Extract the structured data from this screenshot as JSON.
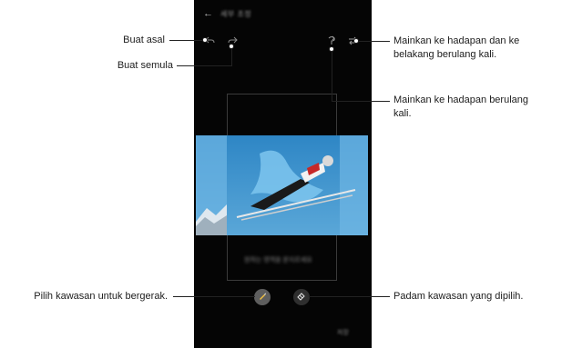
{
  "screen": {
    "title_blurred": "세부 조정",
    "caption_blurred": "원하는 영역을 문지르세요",
    "bottom_blurred": "저장"
  },
  "callouts": {
    "undo": "Buat asal",
    "redo": "Buat semula",
    "loop_forward_backward": [
      "Mainkan ke hadapan dan ke",
      "belakang berulang kali."
    ],
    "loop_forward": [
      "Mainkan ke hadapan berulang",
      "kali."
    ],
    "brush": "Pilih kawasan untuk bergerak.",
    "eraser": "Padam kawasan yang dipilih."
  },
  "icons": [
    "back-arrow-icon",
    "undo-icon",
    "redo-icon",
    "loop-forward-icon",
    "loop-forward-backward-icon",
    "brush-icon",
    "eraser-icon"
  ],
  "colors": {
    "screen_bg": "#050505",
    "sky": "#3f93cc",
    "brush_button": "#5e5e5e",
    "eraser_button": "#2f2f2f"
  }
}
